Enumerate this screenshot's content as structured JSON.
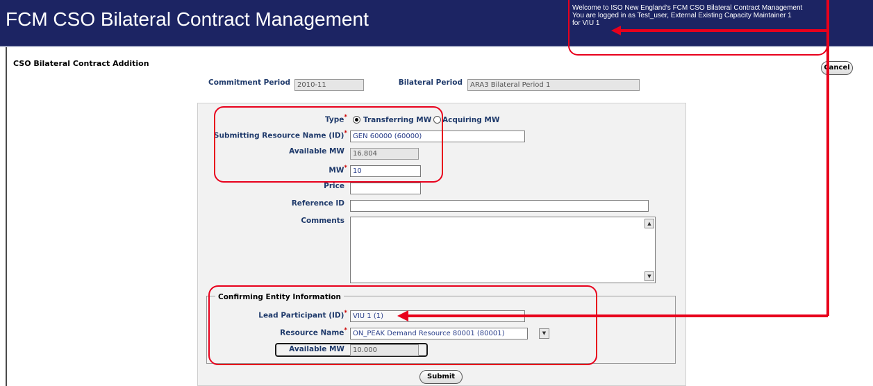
{
  "header": {
    "title": "FCM CSO Bilateral Contract Management",
    "welcome": {
      "line1": "Welcome to ISO New England's FCM CSO Bilateral Contract Management",
      "line2": "You are logged in as Test_user, External Existing Capacity Maintainer 1",
      "line3": "for VIU 1"
    }
  },
  "page": {
    "title": "CSO Bilateral Contract Addition",
    "cancel_label": "Cancel"
  },
  "period": {
    "commitment_label": "Commitment Period",
    "commitment_value": "2010-11",
    "bilateral_label": "Bilateral Period",
    "bilateral_value": "ARA3 Bilateral Period 1"
  },
  "form": {
    "type_label": "Type",
    "type_options": [
      "Transferring MW",
      "Acquiring MW"
    ],
    "type_selected": "Transferring MW",
    "resource_label": "Submitting Resource Name (ID)",
    "resource_value": "GEN 60000 (60000)",
    "available_label": "Available MW",
    "available_value": "16.804",
    "mw_label": "MW",
    "mw_value": "10",
    "price_label": "Price",
    "price_value": "",
    "reference_label": "Reference ID",
    "reference_value": "",
    "comments_label": "Comments",
    "comments_value": "",
    "required_mark": "*"
  },
  "confirming": {
    "legend": "Confirming Entity Information",
    "lead_label": "Lead Participant (ID)",
    "lead_value": "VIU 1 (1)",
    "resource_label": "Resource Name",
    "resource_value": "ON_PEAK Demand Resource 80001 (80001)",
    "available_label": "Available MW",
    "available_value": "10.000"
  },
  "submit_label": "Submit",
  "colors": {
    "header_bg": "#1c2463",
    "label_text": "#1f3a6b",
    "annotation_red": "#e8001c"
  }
}
